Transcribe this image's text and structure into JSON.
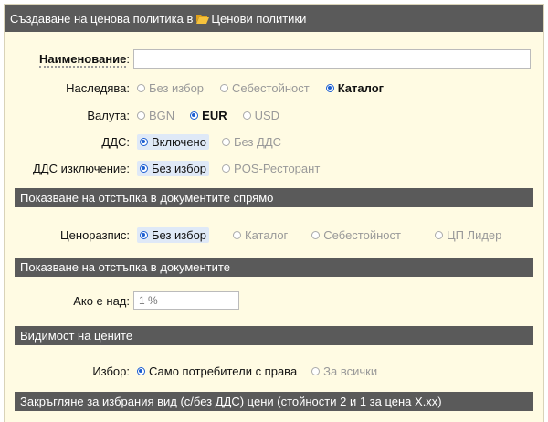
{
  "title": {
    "prefix": "Създаване на ценова политика в",
    "link": "Ценови политики"
  },
  "name_field": {
    "label": "Наименование",
    "colon": ":",
    "value": ""
  },
  "inherits": {
    "label": "Наследява:",
    "options": [
      "Без избор",
      "Себестойност",
      "Каталог"
    ],
    "selected": 2
  },
  "currency": {
    "label": "Валута:",
    "options": [
      "BGN",
      "EUR",
      "USD"
    ],
    "selected": 1
  },
  "vat": {
    "label": "ДДС:",
    "options": [
      "Включено",
      "Без ДДС"
    ],
    "selected": 0
  },
  "vat_exception": {
    "label": "ДДС изключение:",
    "options": [
      "Без избор",
      "POS-Ресторант"
    ],
    "selected": 0
  },
  "section_discount_relative": "Показване на отстъпка в документите спрямо",
  "price_list": {
    "label": "Ценоразпис:",
    "options": [
      "Без избор",
      "Каталог",
      "Себестойност",
      "ЦП Лидер"
    ],
    "selected": 0
  },
  "section_discount": "Показване на отстъпка в документите",
  "if_above": {
    "label": "Ако е над:",
    "placeholder": "1 %"
  },
  "section_visibility": "Видимост на цените",
  "visibility": {
    "label": "Избор:",
    "options": [
      "Само потребители с права",
      "За всички"
    ],
    "selected": 0
  },
  "section_rounding": "Закръгляне за избрания вид (с/без ДДС) цени (стойности 2 и 1 за цена X.xx)",
  "colors": {
    "header_bg": "#5a5a5a",
    "panel_bg": "#fffbe3",
    "radio_accent": "#1d5fd1"
  }
}
